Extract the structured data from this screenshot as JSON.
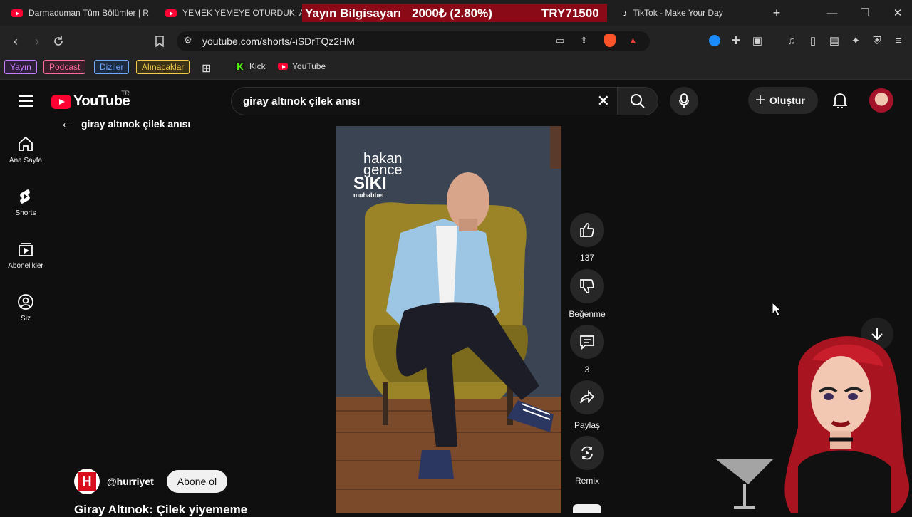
{
  "browser": {
    "tabs": [
      {
        "title": "Darmaduman Tüm Bölümler | R",
        "icon": "youtube-icon"
      },
      {
        "title": "YEMEK YEMEYE OTURDUK, AZ",
        "icon": "youtube-icon"
      },
      {
        "title": "TikTok - Make Your Day",
        "icon": "tiktok-icon"
      }
    ],
    "ticker": {
      "label": "Yayın Bilgisayarı",
      "value": "2000₺ (2.80%)",
      "code": "TRY71500"
    },
    "url": "youtube.com/shorts/-iSDrTQz2HM",
    "bookmarks": {
      "chips": [
        {
          "label": "Yayın",
          "color": "#c77dff"
        },
        {
          "label": "Podcast",
          "color": "#ff6b9a"
        },
        {
          "label": "Diziler",
          "color": "#6ea8ff"
        },
        {
          "label": "Alınacaklar",
          "color": "#f2c94c"
        }
      ],
      "links": [
        {
          "label": "Kick",
          "icon": "kick-icon"
        },
        {
          "label": "YouTube",
          "icon": "youtube-icon"
        }
      ]
    }
  },
  "youtube": {
    "logo_text": "YouTube",
    "country_code": "TR",
    "search_value": "giray altınok çilek anısı",
    "back_label": "giray altınok çilek anısı",
    "create_label": "Oluştur",
    "sidebar": [
      {
        "label": "Ana Sayfa",
        "icon": "home-icon"
      },
      {
        "label": "Shorts",
        "icon": "shorts-icon"
      },
      {
        "label": "Abonelikler",
        "icon": "subscriptions-icon"
      },
      {
        "label": "Siz",
        "icon": "you-icon"
      }
    ],
    "video_overlay": {
      "line1": "hakan",
      "line2": "gence",
      "line3": "SIKI",
      "line4": "muhabbet"
    },
    "actions": [
      {
        "label": "137",
        "icon": "thumbs-up-icon"
      },
      {
        "label": "Beğenme",
        "icon": "thumbs-down-icon"
      },
      {
        "label": "3",
        "icon": "comment-icon"
      },
      {
        "label": "Paylaş",
        "icon": "share-icon"
      },
      {
        "label": "Remix",
        "icon": "remix-icon"
      }
    ],
    "channel": {
      "logo_letter": "H",
      "handle": "@hurriyet",
      "subscribe_label": "Abone ol"
    },
    "video_title": "Giray Altınok: Çilek yiyememe"
  },
  "colors": {
    "ticker_bg": "#8b0a17",
    "youtube_red": "#ff0033"
  }
}
